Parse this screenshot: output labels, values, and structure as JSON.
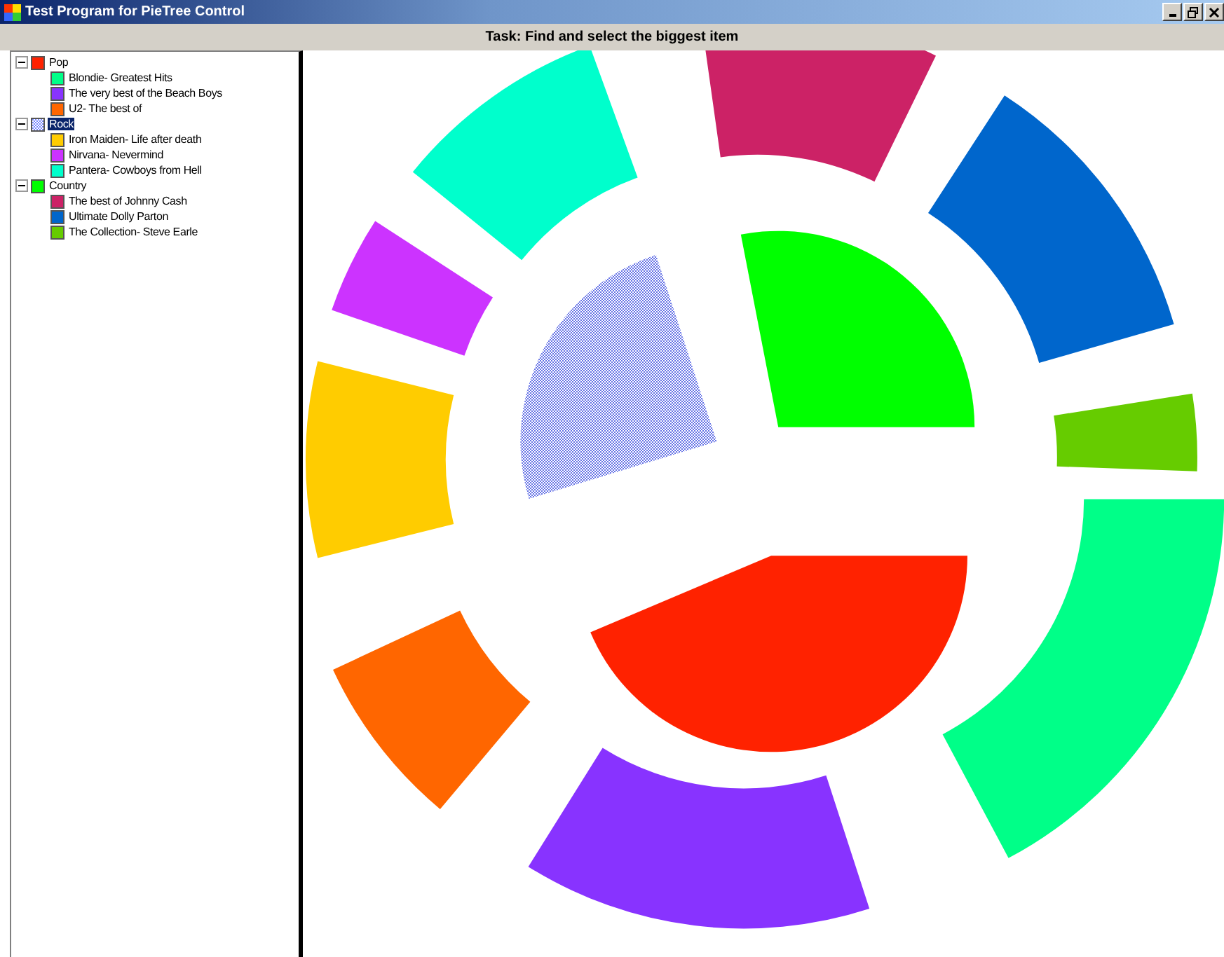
{
  "window": {
    "title": "Test Program for PieTree Control"
  },
  "task": "Task: Find and select the biggest item",
  "tree": [
    {
      "label": "Pop",
      "color": "#ff2200",
      "selected": false,
      "expanded": true,
      "children": [
        {
          "label": "Blondie- Greatest Hits",
          "color": "#00ff88"
        },
        {
          "label": "The very best of the Beach Boys",
          "color": "#8833ff"
        },
        {
          "label": "U2- The best of",
          "color": "#ff6600"
        }
      ]
    },
    {
      "label": "Rock",
      "color": "#7788ff",
      "selected": true,
      "expanded": true,
      "children": [
        {
          "label": "Iron Maiden- Life after death",
          "color": "#ffcc00"
        },
        {
          "label": "Nirvana- Nevermind",
          "color": "#cc33ff"
        },
        {
          "label": "Pantera- Cowboys from Hell",
          "color": "#00ffcc"
        }
      ]
    },
    {
      "label": "Country",
      "color": "#00ff00",
      "selected": false,
      "expanded": true,
      "children": [
        {
          "label": "The best of Johnny Cash",
          "color": "#cc2266"
        },
        {
          "label": "Ultimate Dolly Parton",
          "color": "#0066cc"
        },
        {
          "label": "The Collection- Steve Earle",
          "color": "#66cc00"
        }
      ]
    }
  ]
}
